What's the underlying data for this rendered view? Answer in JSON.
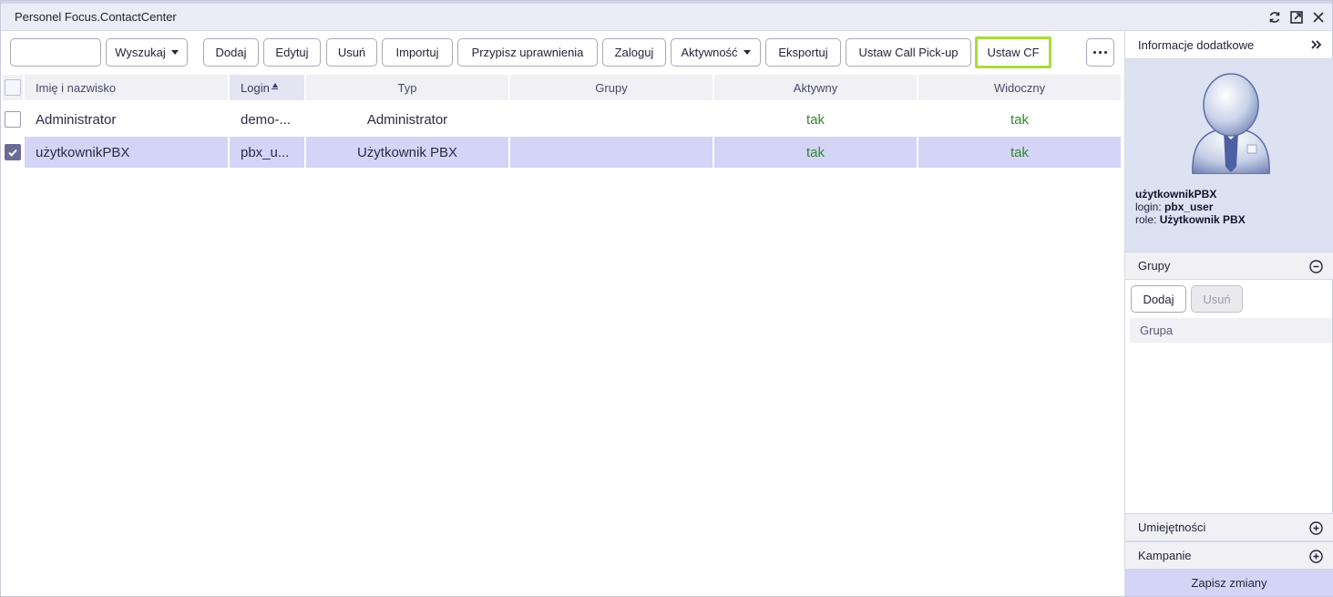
{
  "window": {
    "title": "Personel Focus.ContactCenter"
  },
  "toolbar": {
    "search_value": "",
    "search_dropdown": "Wyszukaj",
    "add": "Dodaj",
    "edit": "Edytuj",
    "delete": "Usuń",
    "import": "Importuj",
    "assign_permissions": "Przypisz uprawnienia",
    "login": "Zaloguj",
    "activity": "Aktywność",
    "export": "Eksportuj",
    "set_call_pickup": "Ustaw Call Pick-up",
    "set_cf": "Ustaw CF"
  },
  "table": {
    "columns": [
      "Imię i nazwisko",
      "Login",
      "Typ",
      "Grupy",
      "Aktywny",
      "Widoczny"
    ],
    "rows": [
      {
        "name": "Administrator",
        "login": "demo-...",
        "type": "Administrator",
        "groups": "",
        "active": "tak",
        "visible": "tak",
        "checked": false
      },
      {
        "name": "użytkownikPBX",
        "login": "pbx_u...",
        "type": "Użytkownik PBX",
        "groups": "",
        "active": "tak",
        "visible": "tak",
        "checked": true
      }
    ]
  },
  "side": {
    "title": "Informacje dodatkowe",
    "profile": {
      "name": "użytkownikPBX",
      "login_label": "login:",
      "login_value": "pbx_user",
      "role_label": "role:",
      "role_value": "Użytkownik PBX"
    },
    "groups": {
      "title": "Grupy",
      "add": "Dodaj",
      "delete": "Usuń",
      "column": "Grupa"
    },
    "skills": "Umiejętności",
    "campaigns": "Kampanie",
    "save": "Zapisz zmiany"
  },
  "colors": {
    "accent": "#d4d4f7",
    "highlight_border": "#a8dc3a",
    "status_green": "#2e8a2e"
  },
  "icons": {
    "title_actions": [
      "refresh-icon",
      "popout-icon",
      "close-icon"
    ],
    "side_collapse": "double-chevron-right-icon",
    "groups_toggle": "minus-circle-icon",
    "skills_toggle": "plus-circle-icon",
    "campaigns_toggle": "plus-circle-icon"
  }
}
